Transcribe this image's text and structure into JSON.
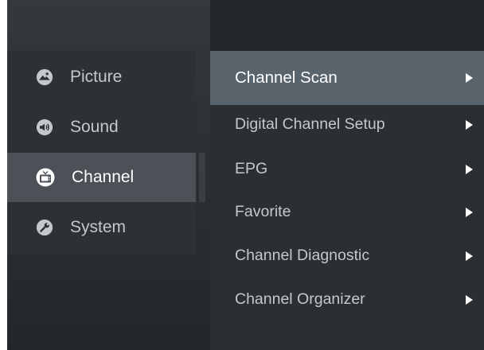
{
  "left_menu": {
    "items": [
      {
        "label": "Picture",
        "icon": "picture-icon"
      },
      {
        "label": "Sound",
        "icon": "sound-icon"
      },
      {
        "label": "Channel",
        "icon": "channel-icon"
      },
      {
        "label": "System",
        "icon": "system-icon"
      }
    ],
    "active": "Channel"
  },
  "channel_menu": {
    "items": [
      {
        "label": "Channel Scan"
      },
      {
        "label": "Digital Channel Setup"
      },
      {
        "label": "EPG"
      },
      {
        "label": "Favorite"
      },
      {
        "label": "Channel Diagnostic"
      },
      {
        "label": "Channel Organizer"
      }
    ],
    "active": "Channel Scan"
  },
  "colors": {
    "background": "#25282b",
    "active_left": "#4b5156",
    "active_right": "#5a646d",
    "text": "#c5c8ca",
    "text_active": "#ffffff"
  }
}
